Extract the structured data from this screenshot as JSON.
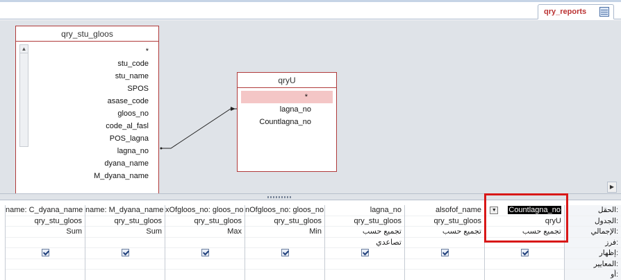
{
  "tab": {
    "label": "qry_reports"
  },
  "tables": [
    {
      "title": "qry_stu_gloos",
      "fields": [
        "*",
        "stu_code",
        "stu_name",
        "SPOS",
        "asase_code",
        "gloos_no",
        "code_al_fasl",
        "POS_lagna",
        "lagna_no",
        "dyana_name",
        "M_dyana_name"
      ]
    },
    {
      "title": "qryU",
      "fields": [
        "*",
        "lagna_no",
        "Countlagna_no"
      ]
    }
  ],
  "row_labels": [
    "الحقل:",
    "الجدول:",
    "الإجمالي:",
    "فرز:",
    "إظهار:",
    "المعايير:",
    "أو:"
  ],
  "grid": {
    "columns": [
      {
        "field": "Countlagna_no",
        "table": "qryU",
        "total": "تجميع حسب",
        "sort": "",
        "show": true
      },
      {
        "field": "alsofof_name",
        "table": "qry_stu_gloos",
        "total": "تجميع حسب",
        "sort": "",
        "show": true
      },
      {
        "field": "lagna_no",
        "table": "qry_stu_gloos",
        "total": "تجميع حسب",
        "sort": "تصاعدي",
        "show": true
      },
      {
        "field": "nOfgloos_no: gloos_no",
        "table": "qry_stu_gloos",
        "total": "Min",
        "sort": "",
        "show": true
      },
      {
        "field": "xOfgloos_no: gloos_no",
        "table": "qry_stu_gloos",
        "total": "Max",
        "sort": "",
        "show": true
      },
      {
        "field": "name: M_dyana_name",
        "table": "qry_stu_gloos",
        "total": "Sum",
        "sort": "",
        "show": true
      },
      {
        "field": "name: C_dyana_name",
        "table": "qry_stu_gloos",
        "total": "Sum",
        "sort": "",
        "show": true
      }
    ]
  }
}
